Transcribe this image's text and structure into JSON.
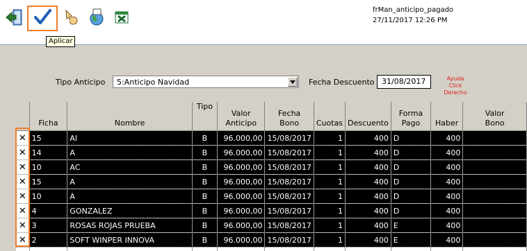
{
  "form": {
    "name": "frMan_anticipo_pagado",
    "datetime": "27/11/2017 12:26 PM"
  },
  "toolbar": {
    "tooltip": "Aplicar",
    "icons": [
      "exit-icon",
      "checkmark-icon",
      "hand-pointer-icon",
      "globe-icon",
      "excel-icon"
    ]
  },
  "filter": {
    "tipo_label": "Tipo Anticipo",
    "tipo_value": "5:Anticipo Navidad",
    "fecha_label": "Fecha Descuento",
    "fecha_value": "31/08/2017",
    "ayuda_line1": "Ayuda Click",
    "ayuda_line2": "Derecho"
  },
  "columns": [
    "Ficha",
    "Nombre",
    "Tipo",
    "Valor\nAnticipo",
    "Fecha\nBono",
    "Cuotas",
    "Descuento",
    "Forma\nPago",
    "Haber",
    "Valor\nBono"
  ],
  "rows": [
    {
      "mark": "✕",
      "ficha": "15",
      "nombre": "Al",
      "tipo": "B",
      "valor": "96.000,00",
      "fecha": "15/08/2017",
      "cuotas": "1",
      "descuento": "400",
      "forma": "D",
      "haber": "400",
      "bono": ""
    },
    {
      "mark": "✕",
      "ficha": "14",
      "nombre": "A",
      "tipo": "B",
      "valor": "96.000,00",
      "fecha": "15/08/2017",
      "cuotas": "1",
      "descuento": "400",
      "forma": "D",
      "haber": "400",
      "bono": ""
    },
    {
      "mark": "✕",
      "ficha": "10",
      "nombre": "AC",
      "tipo": "B",
      "valor": "96.000,00",
      "fecha": "15/08/2017",
      "cuotas": "1",
      "descuento": "400",
      "forma": "D",
      "haber": "400",
      "bono": ""
    },
    {
      "mark": "✕",
      "ficha": "15",
      "nombre": "A",
      "tipo": "B",
      "valor": "96.000,00",
      "fecha": "15/08/2017",
      "cuotas": "1",
      "descuento": "400",
      "forma": "D",
      "haber": "400",
      "bono": ""
    },
    {
      "mark": "✕",
      "ficha": "10",
      "nombre": "A",
      "tipo": "B",
      "valor": "96.000,00",
      "fecha": "15/08/2017",
      "cuotas": "1",
      "descuento": "400",
      "forma": "D",
      "haber": "400",
      "bono": ""
    },
    {
      "mark": "✕",
      "ficha": "4",
      "nombre": "GONZALEZ",
      "tipo": "B",
      "valor": "96.000,00",
      "fecha": "15/08/2017",
      "cuotas": "1",
      "descuento": "400",
      "forma": "D",
      "haber": "400",
      "bono": ""
    },
    {
      "mark": "✕",
      "ficha": "3",
      "nombre": "ROSAS ROJAS PRUEBA",
      "tipo": "B",
      "valor": "96.000,00",
      "fecha": "15/08/2017",
      "cuotas": "1",
      "descuento": "400",
      "forma": "E",
      "haber": "400",
      "bono": ""
    },
    {
      "mark": "✕",
      "ficha": "2",
      "nombre": "SOFT WINPER INNOVA",
      "tipo": "B",
      "valor": "96.000,00",
      "fecha": "15/08/2017",
      "cuotas": "1",
      "descuento": "400",
      "forma": "E",
      "haber": "400",
      "bono": ""
    }
  ]
}
